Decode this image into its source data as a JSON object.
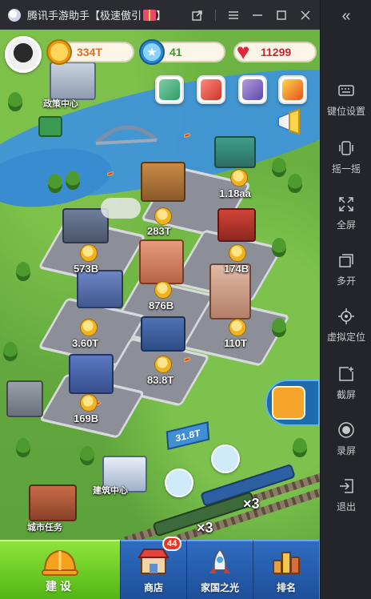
{
  "window": {
    "title": "腾讯手游助手【极速傲引",
    "buttons": [
      "screenshot-window",
      "menu",
      "minimize",
      "maximize",
      "close"
    ]
  },
  "sidebar": {
    "items": [
      {
        "label": "键位设置",
        "icon": "keyboard-icon"
      },
      {
        "label": "摇一摇",
        "icon": "shake-icon"
      },
      {
        "label": "全屏",
        "icon": "fullscreen-icon"
      },
      {
        "label": "多开",
        "icon": "multi-instance-icon"
      },
      {
        "label": "虚拟定位",
        "icon": "location-icon"
      },
      {
        "label": "截屏",
        "icon": "screenshot-icon"
      },
      {
        "label": "录屏",
        "icon": "record-icon"
      },
      {
        "label": "退出",
        "icon": "exit-icon"
      }
    ]
  },
  "hud": {
    "coins": "334T",
    "stars": "41",
    "hearts": "11299"
  },
  "map": {
    "labels": {
      "government": "政策中心",
      "construction": "建筑中心",
      "city_task": "城市任务"
    },
    "incomes": [
      "1.18aa",
      "283T",
      "573B",
      "174B",
      "876B",
      "3.60T",
      "110T",
      "83.8T",
      "169B"
    ],
    "billboard": "31.8T",
    "multipliers": [
      "×3",
      "×3"
    ]
  },
  "bottom_nav": {
    "tabs": [
      {
        "label": "建设",
        "icon": "hardhat-icon"
      },
      {
        "label": "商店",
        "icon": "shop-icon"
      },
      {
        "label": "家国之光",
        "icon": "rocket-icon"
      },
      {
        "label": "排名",
        "icon": "ranking-icon"
      }
    ],
    "shop_badge": "44"
  },
  "colors": {
    "titlebar": "#2a2c31",
    "sidebar": "#23252a",
    "build_tab": "#6fd02a",
    "nav_blue": "#2560b0",
    "coin_gold": "#f0b21e",
    "heart_red": "#e0283a",
    "star_blue": "#3aa0e8"
  }
}
